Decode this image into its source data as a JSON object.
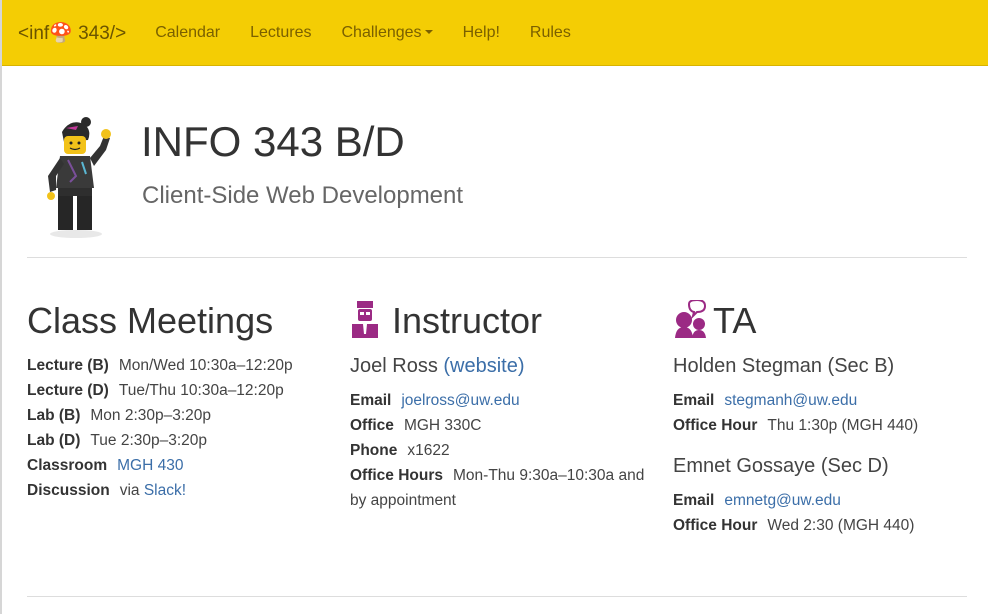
{
  "navbar": {
    "brand": "<inf🍄 343/>",
    "links": [
      "Calendar",
      "Lectures",
      "Challenges",
      "Help!",
      "Rules"
    ]
  },
  "header": {
    "title": "INFO 343 B/D",
    "subtitle": "Client-Side Web Development"
  },
  "class_meetings": {
    "heading": "Class Meetings",
    "rows": [
      {
        "label": "Lecture (B)",
        "value": "Mon/Wed 10:30a–12:20p"
      },
      {
        "label": "Lecture (D)",
        "value": "Tue/Thu 10:30a–12:20p"
      },
      {
        "label": "Lab (B)",
        "value": "Mon 2:30p–3:20p"
      },
      {
        "label": "Lab (D)",
        "value": "Tue 2:30p–3:20p"
      }
    ],
    "classroom": {
      "label": "Classroom",
      "link": "MGH 430"
    },
    "discussion": {
      "label": "Discussion",
      "prefix": "via",
      "link": "Slack",
      "suffix": "!"
    }
  },
  "instructor": {
    "heading": "Instructor",
    "name": "Joel Ross",
    "website_link": "(website)",
    "email_label": "Email",
    "email": "joelross@uw.edu",
    "office_label": "Office",
    "office": "MGH 330C",
    "phone_label": "Phone",
    "phone": "x1622",
    "hours_label": "Office Hours",
    "hours_line1": "Mon-Thu 9:30a–10:30a and",
    "hours_line2": "by appointment"
  },
  "ta": {
    "heading": "TA",
    "people": [
      {
        "name": "Holden Stegman (Sec B)",
        "email_label": "Email",
        "email": "stegmanh@uw.edu",
        "hour_label": "Office Hour",
        "hour": "Thu 1:30p (MGH 440)"
      },
      {
        "name": "Emnet Gossaye (Sec D)",
        "email_label": "Email",
        "email": "emnetg@uw.edu",
        "hour_label": "Office Hour",
        "hour": "Wed 2:30 (MGH 440)"
      }
    ]
  },
  "colors": {
    "navbar": "#f4cd04",
    "link": "#3b6ea8",
    "icon": "#9b2a84"
  },
  "icons": [
    "lego-figure-image",
    "instructor-icon",
    "ta-icon"
  ]
}
